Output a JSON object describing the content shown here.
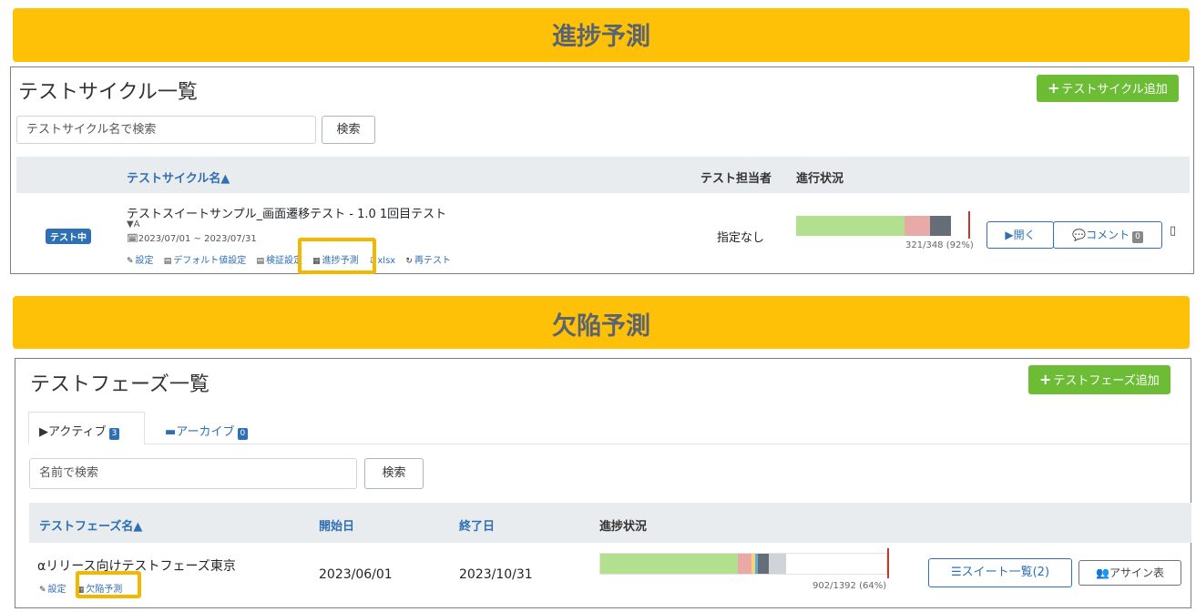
{
  "banner_progress": "進捗予測",
  "banner_defect": "欠陥予測",
  "cycle_panel": {
    "title": "テストサイクル一覧",
    "add_button": "テストサイクル追加",
    "search_placeholder": "テストサイクル名で検索",
    "search_button": "検索",
    "columns": {
      "name": "テストサイクル名▲",
      "owner": "テスト担当者",
      "status": "進行状況"
    },
    "row": {
      "status_badge": "テスト中",
      "name": "テストスイートサンプル_画面遷移テスト - 1.0 1回目テスト",
      "tag": "A",
      "period": "2023/07/01 ~ 2023/07/31",
      "links": [
        "設定",
        "デフォルト値設定",
        "検証設定",
        "進捗予測",
        "xlsx",
        "再テスト"
      ],
      "owner": "指定なし",
      "progress_text": "321/348 (92%)",
      "progress": {
        "pass": 0.625,
        "fail": 0.15,
        "blocked": 0.12,
        "remaining": 0.105
      },
      "open_button": "開く",
      "comment_button": "コメント",
      "comment_count": "0"
    }
  },
  "phase_panel": {
    "title": "テストフェーズ一覧",
    "add_button": "テストフェーズ追加",
    "tabs": [
      {
        "label": "アクティブ",
        "count": "3"
      },
      {
        "label": "アーカイブ",
        "count": "0"
      }
    ],
    "search_placeholder": "名前で検索",
    "search_button": "検索",
    "columns": {
      "name": "テストフェーズ名▲",
      "start": "開始日",
      "end": "終了日",
      "progress": "進捗状況"
    },
    "row": {
      "name": "αリリース向けテストフェーズ東京",
      "links": [
        "設定",
        "欠陥予測"
      ],
      "start": "2023/06/01",
      "end": "2023/10/31",
      "progress_text": "902/1392 (64%)",
      "progress": {
        "pass": 0.48,
        "fail": 0.05,
        "other1": 0.01,
        "other2": 0.01,
        "blocked": 0.04,
        "skipped": 0.06,
        "remaining": 0.35
      },
      "suite_button": "スイート一覧(2)",
      "assign_button": "アサイン表"
    }
  },
  "colors": {
    "banner": "#ffc107",
    "pass": "#b3e08e",
    "fail": "#e9a9a6",
    "blocked": "#656d78",
    "skipped": "#d0d4d9",
    "accent": "#2f6fb4",
    "add": "#6cbd35"
  }
}
